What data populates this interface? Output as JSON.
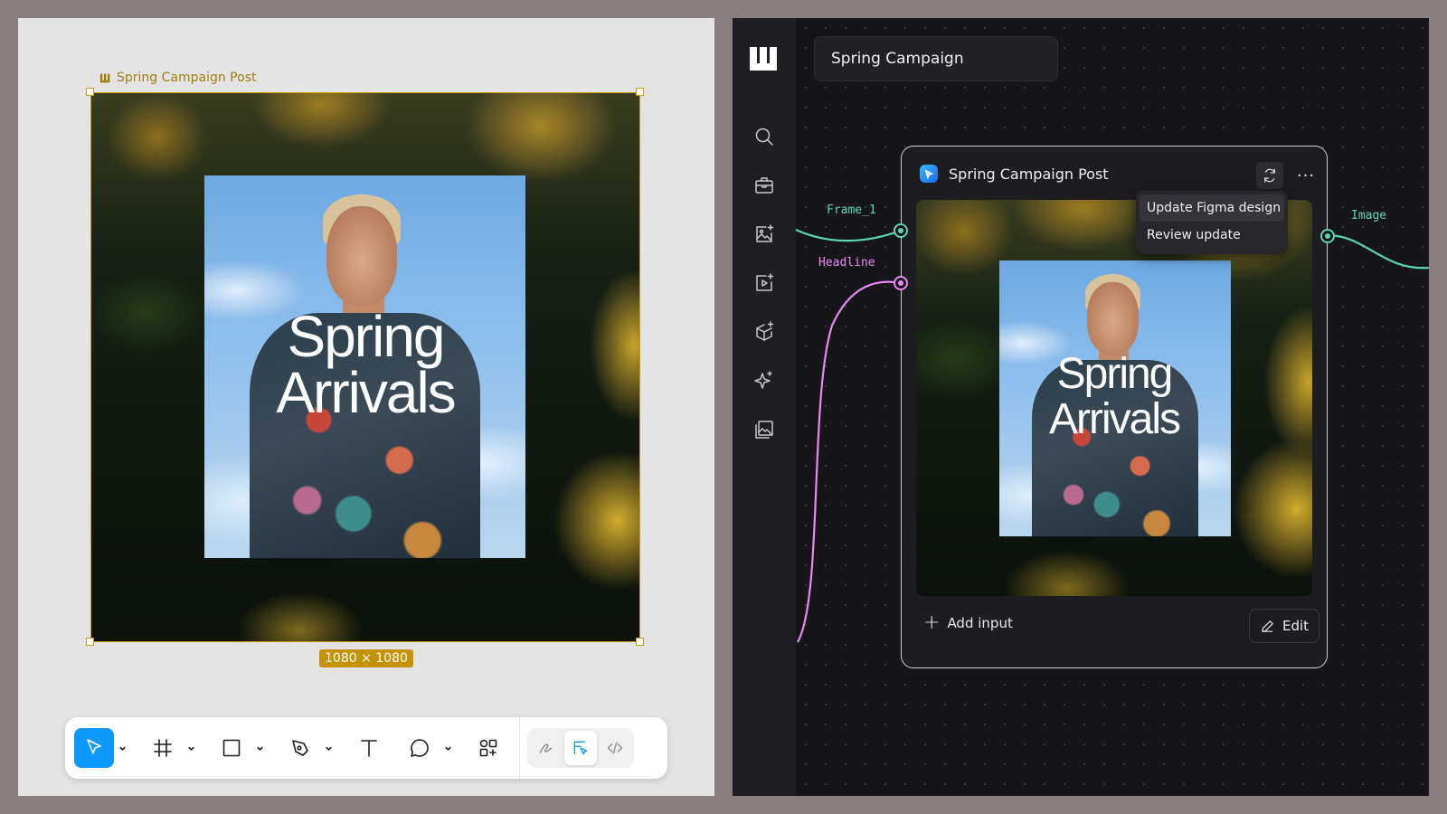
{
  "figma": {
    "frame_label": "Spring Campaign Post",
    "dimensions": "1080 × 1080",
    "headline_line1": "Spring",
    "headline_line2": "Arrivals",
    "toolbar": {
      "tools": [
        {
          "name": "move",
          "icon": "cursor-icon",
          "active": true
        },
        {
          "name": "frame",
          "icon": "frame-icon"
        },
        {
          "name": "rectangle",
          "icon": "rectangle-icon"
        },
        {
          "name": "pen",
          "icon": "pen-icon"
        },
        {
          "name": "text",
          "icon": "text-icon"
        },
        {
          "name": "comment",
          "icon": "comment-icon"
        },
        {
          "name": "actions",
          "icon": "components-icon"
        }
      ],
      "modes": [
        {
          "name": "draw",
          "icon": "draw-icon"
        },
        {
          "name": "design",
          "icon": "design-icon",
          "active": true
        },
        {
          "name": "dev",
          "icon": "code-icon"
        }
      ],
      "active_color": "#0d99ff"
    }
  },
  "weavy": {
    "project_title": "Spring Campaign",
    "sidebar_icons": [
      "search-icon",
      "briefcase-icon",
      "image-sparkle-icon",
      "video-sparkle-icon",
      "cube-sparkle-icon",
      "sparkle-icon",
      "gallery-icon"
    ],
    "node": {
      "title": "Spring Campaign Post",
      "headline_line1": "Spring",
      "headline_line2": "Arrivals",
      "add_input_label": "Add input",
      "edit_label": "Edit",
      "more_label": "···"
    },
    "menu": {
      "items": [
        "Update Figma design",
        "Review update"
      ]
    },
    "ports": {
      "frame_input": {
        "label": "Frame_1",
        "color": "#5fd4b4"
      },
      "headline_input": {
        "label": "Headline",
        "color": "#e58af0"
      },
      "image_output": {
        "label": "Image",
        "color": "#5fd4b4"
      }
    }
  }
}
